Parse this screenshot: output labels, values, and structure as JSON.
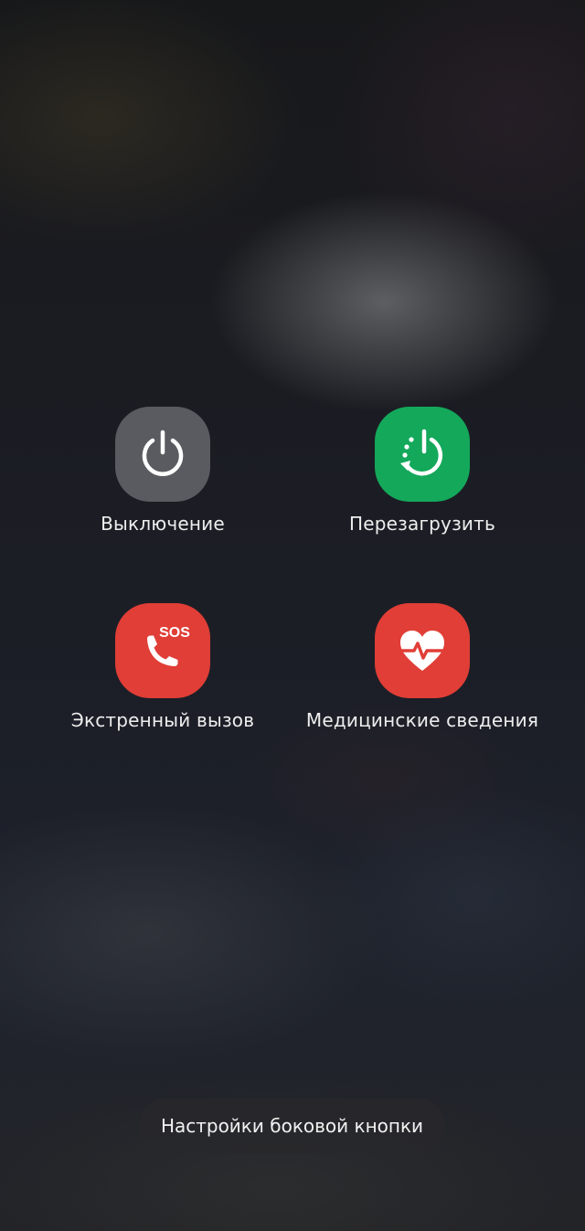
{
  "power_menu": {
    "actions": [
      {
        "label": "Выключение",
        "icon": "power-icon",
        "color": "#5a5b60"
      },
      {
        "label": "Перезагрузить",
        "icon": "restart-icon",
        "color": "#14a85b"
      },
      {
        "label": "Экстренный вызов",
        "icon": "sos-call-icon",
        "color": "#e03e36",
        "icon_text": "SOS"
      },
      {
        "label": "Медицинские сведения",
        "icon": "heart-pulse-icon",
        "color": "#e03e36"
      }
    ],
    "side_key_settings_label": "Настройки боковой кнопки"
  }
}
